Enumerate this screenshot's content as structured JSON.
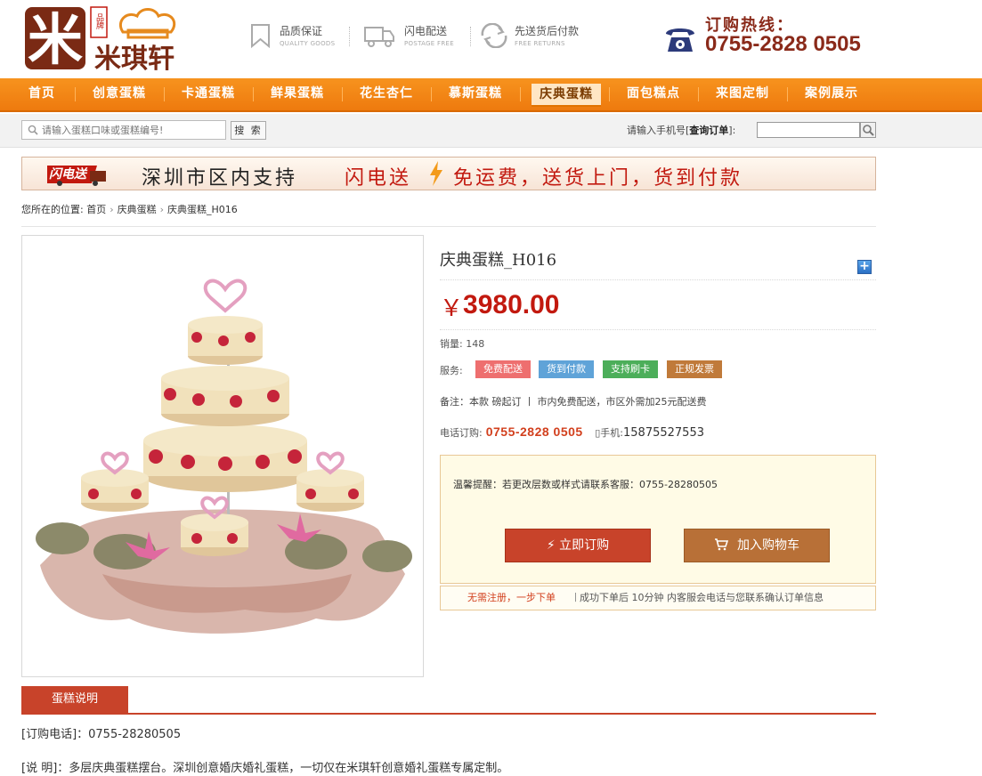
{
  "header": {
    "logo_text": "米琪轩",
    "logo_mark": "米",
    "logo_seal": "品牌",
    "features": [
      {
        "title": "品质保证",
        "sub": "QUALITY GOODS",
        "icon": "bookmark-icon"
      },
      {
        "title": "闪电配送",
        "sub": "POSTAGE FREE",
        "icon": "truck-icon"
      },
      {
        "title": "先送货后付款",
        "sub": "FREE RETURNS",
        "icon": "return-icon"
      }
    ],
    "hotline_label": "订购热线：",
    "hotline_number": "0755-2828 0505"
  },
  "nav": {
    "items": [
      "首页",
      "创意蛋糕",
      "卡通蛋糕",
      "鲜果蛋糕",
      "花生杏仁",
      "慕斯蛋糕",
      "庆典蛋糕",
      "面包糕点",
      "来图定制",
      "案例展示"
    ],
    "active": "庆典蛋糕"
  },
  "search": {
    "placeholder": "请输入蛋糕口味或蛋糕编号!",
    "button": "搜 索",
    "order_label_prefix": "请输入手机号[",
    "order_label_bold": "查询订单",
    "order_label_suffix": "]:"
  },
  "banner": {
    "badge": "闪电送",
    "text1": "深圳市区内支持",
    "text2": "闪电送",
    "text3": "免运费，送货上门，货到付款"
  },
  "breadcrumb": {
    "prefix": "您所在的位置:",
    "items": [
      "首页",
      "庆典蛋糕",
      "庆典蛋糕_H016"
    ]
  },
  "product": {
    "title": "庆典蛋糕_H016",
    "currency": "￥",
    "price": "3980.00",
    "sales_label": "销量:",
    "sales_value": "148",
    "service_label": "服务:",
    "tags": [
      {
        "label": "免费配送",
        "color": "#ee6f6f"
      },
      {
        "label": "货到付款",
        "color": "#5fa3d8"
      },
      {
        "label": "支持刷卡",
        "color": "#4cae5a"
      },
      {
        "label": "正规发票",
        "color": "#c07a3a"
      }
    ],
    "note": "备注：本款  磅起订  丨 市内免费配送，市区外需加25元配送费",
    "phone_label": "电话订购:",
    "phone_number": "0755-2828 0505",
    "mobile_label": "手机:",
    "mobile_number": "15875527553",
    "tip": "温馨提醒：若更改层数或样式请联系客服：0755-28280505",
    "buy_label": "立即订购",
    "cart_label": "加入购物车",
    "strip_1": "无需注册，一步下单",
    "strip_sep": "丨",
    "strip_2": "成功下单后 10分钟 内客服会电话与您联系确认订单信息"
  },
  "detail": {
    "tab": "蛋糕说明",
    "line1": "[订购电话]：0755-28280505",
    "line2": "[说  明]：多层庆典蛋糕摆台。深圳创意婚庆婚礼蛋糕，一切仅在米琪轩创意婚礼蛋糕专属定制。"
  },
  "colors": {
    "nav_orange": "#f7931e",
    "brand_red": "#c2190f",
    "button_red": "#c8432a",
    "button_brown": "#b87037"
  }
}
